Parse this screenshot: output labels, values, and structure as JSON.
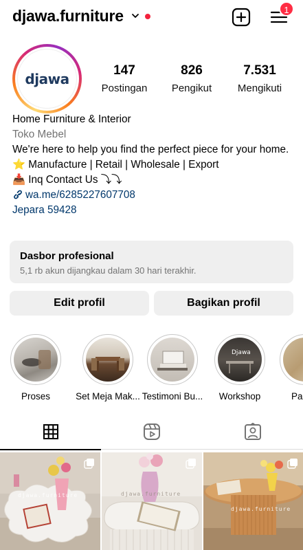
{
  "header": {
    "username": "djawa.furniture",
    "notification_count": "1",
    "icons": [
      "chevron-down-icon",
      "new-post-icon",
      "menu-icon"
    ]
  },
  "profile": {
    "logo_text": "djawa",
    "stats": [
      {
        "value": "147",
        "label": "Postingan"
      },
      {
        "value": "826",
        "label": "Pengikut"
      },
      {
        "value": "7.531",
        "label": "Mengikuti"
      }
    ],
    "bio": {
      "name": "Home Furniture & Interior",
      "category": "Toko Mebel",
      "line1": "We're here to help you find the perfect piece for your home.",
      "line2": "⭐ Manufacture | Retail | Wholesale | Export",
      "line3": "📥 Inq Contact Us ⤵⤵",
      "link": "wa.me/6285227607708",
      "location": "Jepara 59428"
    }
  },
  "dashboard": {
    "title": "Dasbor profesional",
    "subtitle": "5,1 rb akun dijangkau dalam 30 hari terakhir."
  },
  "actions": {
    "edit_label": "Edit profil",
    "share_label": "Bagikan profil"
  },
  "highlights": [
    {
      "label": "Proses"
    },
    {
      "label": "Set Meja Mak..."
    },
    {
      "label": "Testimoni Bu..."
    },
    {
      "label": "Workshop"
    },
    {
      "label": "Pa"
    }
  ],
  "highlight_texts": {
    "workshop_overlay": "Djawa"
  },
  "tabs": [
    "grid-icon",
    "reels-icon",
    "tagged-icon"
  ],
  "posts": [
    {
      "watermark": "djawa.furniture"
    },
    {
      "watermark": "djawa.furniture"
    },
    {
      "watermark": "djawa.furniture"
    }
  ],
  "colors": {
    "accent_link": "#00376b",
    "notification_red": "#ff2d44",
    "button_bg": "#efefef"
  }
}
